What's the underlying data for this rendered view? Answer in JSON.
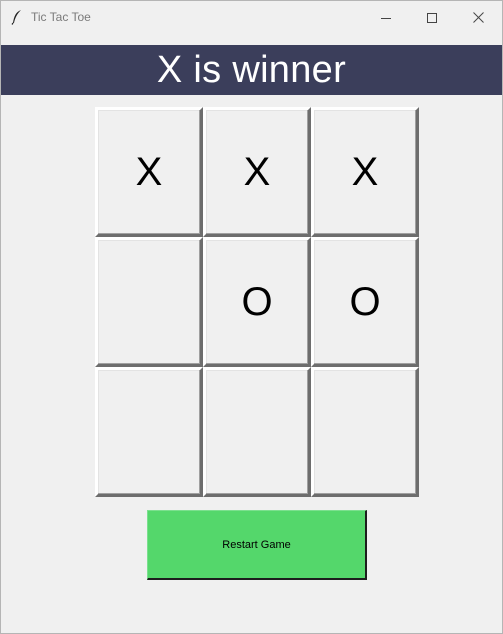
{
  "window": {
    "title": "Tic Tac Toe"
  },
  "status": {
    "text": "X is winner",
    "background": "#3b3e5b",
    "color": "#ffffff"
  },
  "board": {
    "cells": [
      "X",
      "X",
      "X",
      "",
      "O",
      "O",
      "",
      "",
      ""
    ]
  },
  "restart": {
    "label": "Restart Game",
    "background": "#54d76b"
  },
  "icons": {
    "app": "feather-icon",
    "minimize": "minimize-icon",
    "maximize": "maximize-icon",
    "close": "close-icon"
  }
}
